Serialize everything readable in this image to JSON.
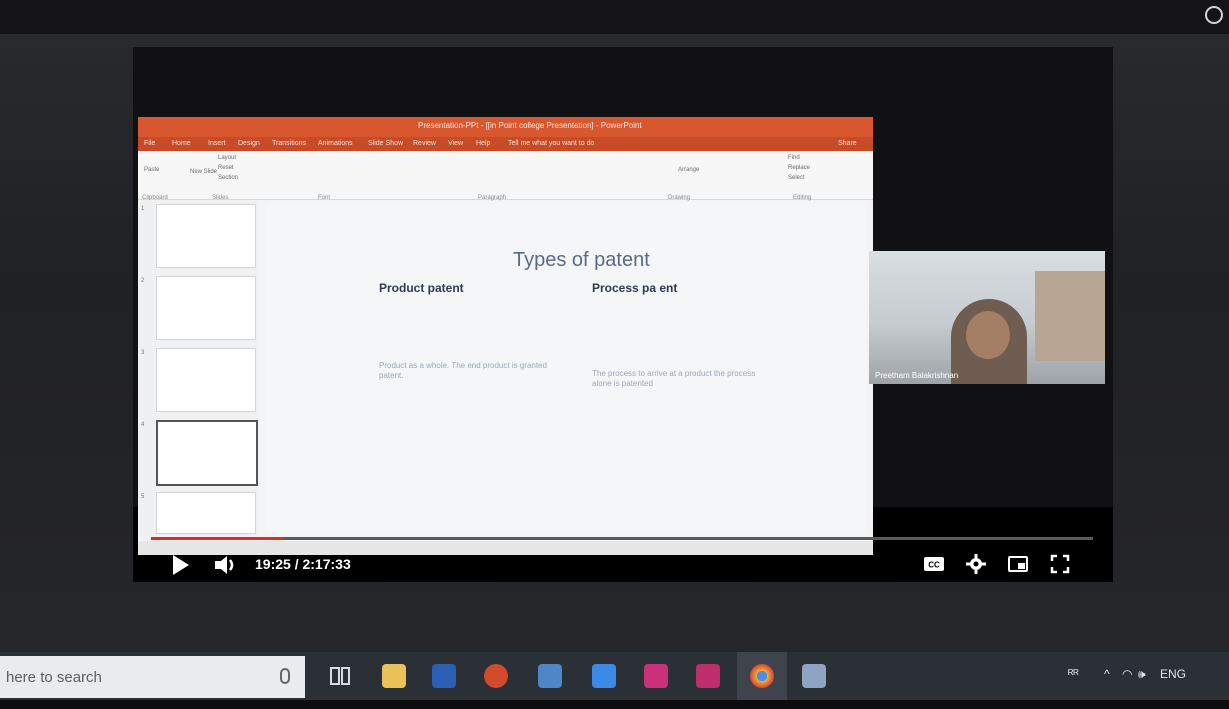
{
  "powerpoint": {
    "window_title": "Presentation-PPt - [[in Point college Presentation] - PowerPoint",
    "menu": [
      "File",
      "Home",
      "Insert",
      "Design",
      "Transitions",
      "Animations",
      "Slide Show",
      "Review",
      "View",
      "Help",
      "Tell me what you want to do"
    ],
    "share": "Share",
    "ribbon_groups": [
      "Clipboard",
      "Slides",
      "Font",
      "Paragraph",
      "Drawing",
      "Editing"
    ],
    "ribbon_items": [
      "Layout",
      "Reset",
      "Section",
      "New Slide",
      "Paste",
      "Arrange",
      "Find",
      "Replace",
      "Select"
    ],
    "slide": {
      "title": "Types of patent",
      "left_heading": "Product patent",
      "right_heading": "Process pa ent",
      "left_bullet": "Product as a whole. The end product is granted patent.",
      "right_bullet": "The process to arrive at a product the process alone is patented"
    },
    "thumbnail_numbers": [
      "1",
      "2",
      "3",
      "4",
      "5"
    ]
  },
  "webcam": {
    "participant_name": "Preetham Balakrishnan"
  },
  "player": {
    "time": "19:25 / 2:17:33",
    "progress_fraction": 0.14,
    "accent_color": "#e02b21"
  },
  "taskbar": {
    "search_placeholder": "here to search",
    "tray_font_icon": "ᴿᴿ",
    "tray_language": "ENG",
    "tray_volume": "🕪"
  }
}
